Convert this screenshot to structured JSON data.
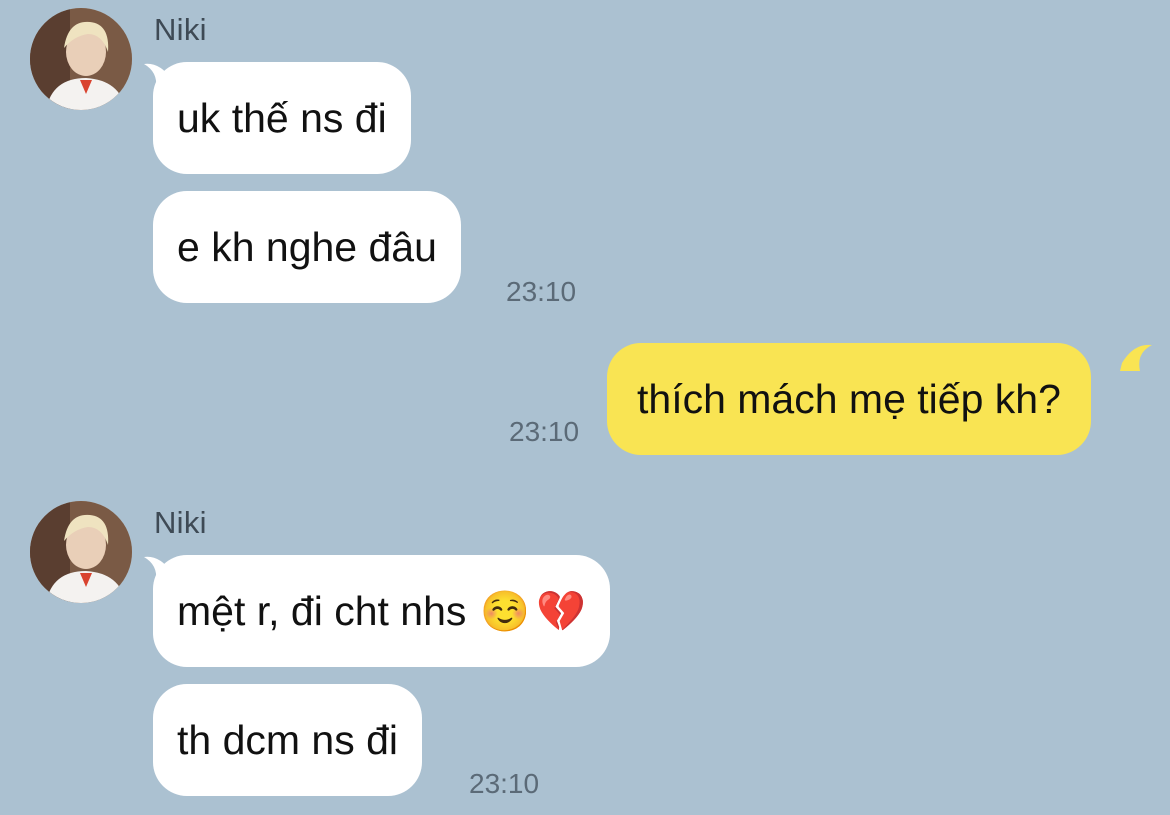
{
  "conversation": {
    "group1": {
      "sender": "Niki",
      "messages": [
        {
          "text": "uk thế ns đi"
        },
        {
          "text": "e kh nghe đâu"
        }
      ],
      "time": "23:10"
    },
    "outgoing": {
      "text": "thích mách mẹ tiếp kh?",
      "time": "23:10"
    },
    "group2": {
      "sender": "Niki",
      "messages": [
        {
          "text": "mệt r, đi cht nhs",
          "emoji1": "☺️",
          "emoji2": "💔"
        },
        {
          "text": "th dcm ns đi"
        }
      ],
      "time": "23:10"
    }
  },
  "colors": {
    "background": "#abc1d1",
    "incoming_bubble": "#ffffff",
    "outgoing_bubble": "#f9e453"
  }
}
